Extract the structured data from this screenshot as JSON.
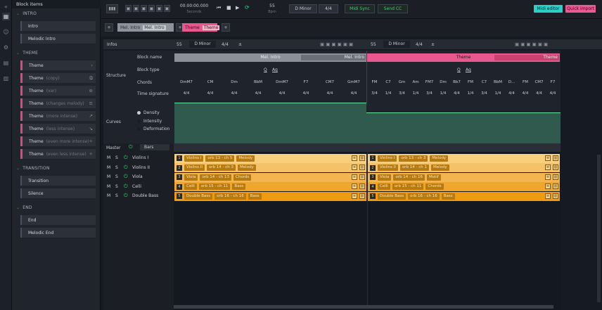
{
  "sidebar_rail": {
    "icons": [
      "grid-icon",
      "user-icon",
      "gear-icon",
      "folder-icon",
      "panel-icon"
    ]
  },
  "left_panel": {
    "title": "Block items",
    "categories": [
      {
        "name": "INTRO",
        "items": [
          {
            "label": "Intro",
            "sub": ""
          },
          {
            "label": "Melodic Intro",
            "sub": ""
          }
        ]
      },
      {
        "name": "THEME",
        "items": [
          {
            "label": "Theme",
            "sub": "",
            "icon": "›"
          },
          {
            "label": "Theme",
            "sub": "(copy)",
            "icon": "⧉"
          },
          {
            "label": "Theme",
            "sub": "(var)",
            "icon": "⊜"
          },
          {
            "label": "Theme",
            "sub": "(changes melody)",
            "icon": "≡"
          },
          {
            "label": "Theme",
            "sub": "(more intense)",
            "icon": "↗"
          },
          {
            "label": "Theme",
            "sub": "(less intense)",
            "icon": "↘"
          },
          {
            "label": "Theme",
            "sub": "(even more intense)",
            "icon": "✧"
          },
          {
            "label": "Theme",
            "sub": "(even less intense)",
            "icon": "✧"
          }
        ]
      },
      {
        "name": "TRANSITION",
        "items": [
          {
            "label": "Transition",
            "sub": ""
          },
          {
            "label": "Silence",
            "sub": ""
          }
        ]
      },
      {
        "name": "END",
        "items": [
          {
            "label": "End",
            "sub": ""
          },
          {
            "label": "Melodic End",
            "sub": ""
          }
        ]
      }
    ]
  },
  "transport": {
    "time": "00:00:00.000",
    "time_unit": "Seconds",
    "tempo": "55",
    "tempo_unit": "Bpm",
    "key": "D Minor",
    "signature": "4/4",
    "midi_sync": "Midi Sync",
    "send_cc": "Send CC",
    "midi_editor": "Midi editor",
    "quick_import": "Quick import"
  },
  "blockbar": {
    "blocks": [
      {
        "name": "Mel. Intro",
        "tag": "Mel. Intro",
        "color": "#8d929c"
      },
      {
        "name": "Theme",
        "tag": "Theme",
        "color": "#e8578d"
      }
    ],
    "add": "+"
  },
  "infos": {
    "label": "Infos",
    "sections": [
      {
        "tempo": "55",
        "key": "D Minor",
        "sig": "4/4",
        "plus": "±"
      },
      {
        "tempo": "55",
        "key": "D Minor",
        "sig": "4/4",
        "plus": "±"
      }
    ],
    "structure_label": "Structure",
    "rows": [
      "Block name",
      "Block type",
      "Chords",
      "Time signature"
    ],
    "block_names": [
      "Mel. Intro",
      "Mel. Intro",
      "Theme",
      "Theme"
    ],
    "block_types": [
      "Q",
      "Aq",
      "Q",
      "Aq"
    ],
    "chords_a": [
      "DmM7",
      "CM",
      "Dm",
      "BbM",
      "DmM7",
      "F7",
      "CM7",
      "GmM7"
    ],
    "chords_b": [
      "FM",
      "C7",
      "Gm",
      "Am",
      "FM7",
      "Dm",
      "Bb7",
      "FM",
      "C7",
      "BbM",
      "D...",
      "FM",
      "CM7",
      "F7"
    ],
    "sigs_a": [
      "4/4",
      "4/4",
      "4/4",
      "4/4",
      "4/4",
      "4/4",
      "4/4",
      "4/4"
    ],
    "sigs_b": [
      "3/4",
      "1/4",
      "3/4",
      "1/4",
      "3/4",
      "1/4",
      "4/4",
      "1/4",
      "3/4",
      "1/4",
      "4/4",
      "4/4",
      "4/4",
      "4/4"
    ],
    "curves_label": "Curves",
    "curves": [
      "Density",
      "Intensity",
      "Deformation"
    ]
  },
  "mixer": {
    "master": "Master",
    "grid": "Bars",
    "tracks": [
      {
        "m": "M",
        "s": "S",
        "name": "Violins I",
        "num": "1",
        "tags_a": [
          "Violins I",
          "orb 13 - ch 5",
          "Melody"
        ],
        "tags_b": [
          "Violins I",
          "orb 13 - ch 3",
          "Melody"
        ],
        "color": "#f7cf7d"
      },
      {
        "m": "M",
        "s": "S",
        "name": "Violins II",
        "num": "2",
        "tags_a": [
          "Violins II",
          "orb 14 - ch 3",
          "Melody"
        ],
        "tags_b": [
          "Violins II",
          "orb 14 - ch 1",
          "Melody"
        ],
        "color": "#f4c268"
      },
      {
        "m": "M",
        "s": "S",
        "name": "Viola",
        "num": "3",
        "tags_a": [
          "Viola",
          "orb 14 - ch 13",
          "Chords"
        ],
        "tags_b": [
          "Viola",
          "orb 14 - ch 16",
          "Motif"
        ],
        "color": "#f2b54f"
      },
      {
        "m": "M",
        "s": "S",
        "name": "Celli",
        "num": "4",
        "tags_a": [
          "Celli",
          "orb 15 - ch 11",
          "Bass"
        ],
        "tags_b": [
          "Celli",
          "orb 15 - ch 11",
          "Chords"
        ],
        "color": "#f0a52c"
      },
      {
        "m": "M",
        "s": "S",
        "name": "Double Bass",
        "num": "5",
        "tags_a": [
          "Double Bass",
          "orb 16 - ch 16",
          "Bass"
        ],
        "tags_b": [
          "Double Bass",
          "orb 16 - ch 16",
          "Bass"
        ],
        "color": "#ee9b12"
      }
    ]
  }
}
